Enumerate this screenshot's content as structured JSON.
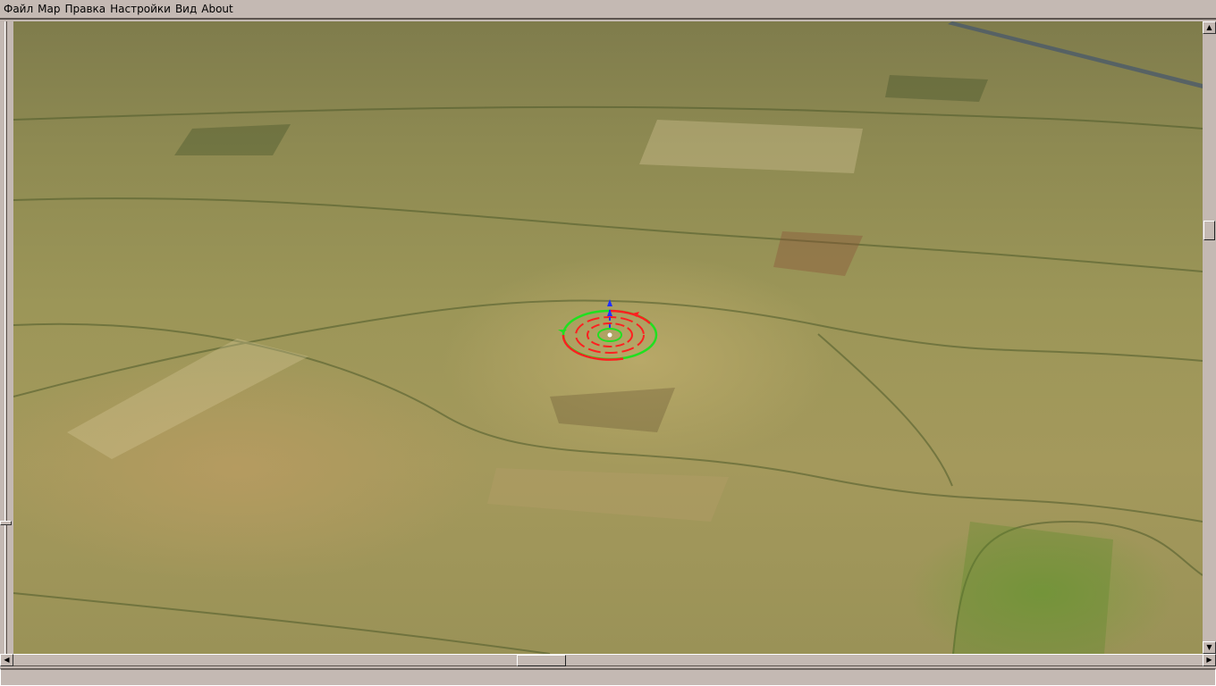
{
  "menu": {
    "items": [
      "Файл",
      "Map",
      "Правка",
      "Настройки",
      "Вид",
      "About"
    ]
  },
  "scrollbars": {
    "vertical_position_percent": 33,
    "horizontal_position_percent": 44,
    "left_slider_position_percent": 79
  },
  "status_bar": {
    "text": ""
  },
  "colors": {
    "chrome": "#c4b9b3",
    "gizmo_red": "#ff2020",
    "gizmo_green": "#20e020",
    "gizmo_blue": "#2030ff"
  }
}
